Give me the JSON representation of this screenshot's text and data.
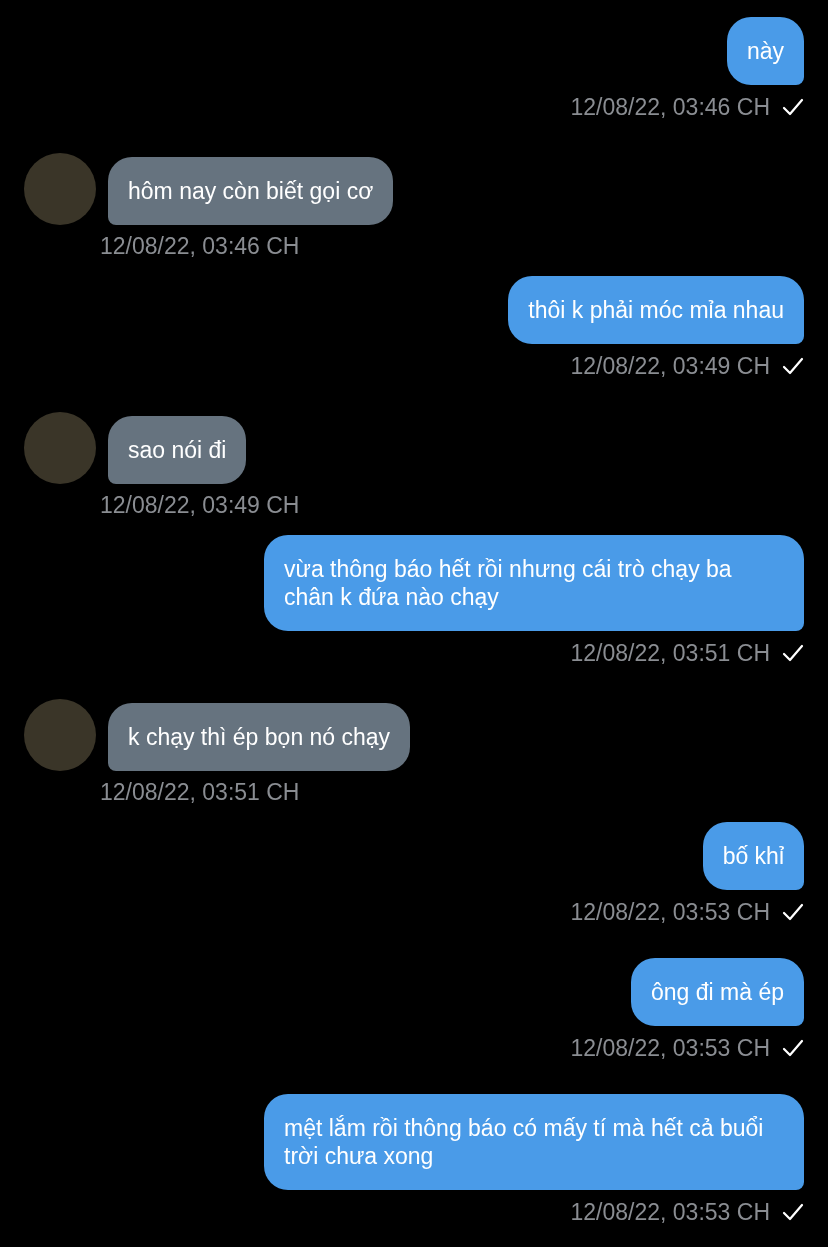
{
  "messages": [
    {
      "kind": "sent",
      "text": "này",
      "time": "12/08/22, 03:46 CH"
    },
    {
      "kind": "received",
      "text": "hôm nay còn biết gọi cơ",
      "time": "12/08/22, 03:46 CH"
    },
    {
      "kind": "sent",
      "text": "thôi k phải móc mỉa nhau",
      "time": "12/08/22, 03:49 CH"
    },
    {
      "kind": "received",
      "text": "sao nói đi",
      "time": "12/08/22, 03:49 CH"
    },
    {
      "kind": "sent",
      "text": "vừa thông báo hết rồi nhưng cái trò chạy ba chân k đứa nào chạy",
      "time": "12/08/22, 03:51 CH"
    },
    {
      "kind": "received",
      "text": "k chạy thì ép bọn nó chạy",
      "time": "12/08/22, 03:51 CH"
    },
    {
      "kind": "sent",
      "text": "bố khỉ",
      "time": "12/08/22, 03:53 CH"
    },
    {
      "kind": "sent",
      "text": "ông đi mà ép",
      "time": "12/08/22, 03:53 CH"
    },
    {
      "kind": "sent",
      "text": "mệt lắm rồi thông báo có mấy tí mà hết cả buổi trời chưa xong",
      "time": "12/08/22, 03:53 CH"
    }
  ]
}
